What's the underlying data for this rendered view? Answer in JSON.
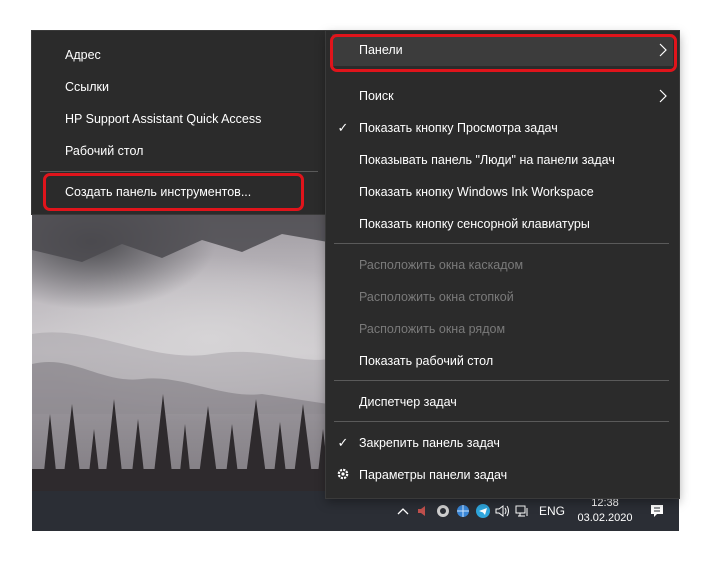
{
  "submenu": {
    "items": [
      {
        "label": "Адрес"
      },
      {
        "label": "Ссылки"
      },
      {
        "label": "HP Support Assistant Quick Access"
      },
      {
        "label": "Рабочий стол"
      }
    ],
    "create_label": "Создать панель инструментов..."
  },
  "menu": {
    "panels_label": "Панели",
    "search_label": "Поиск",
    "task_view_label": "Показать кнопку Просмотра задач",
    "people_label": "Показывать панель \"Люди\" на панели задач",
    "ink_label": "Показать кнопку Windows Ink Workspace",
    "keyboard_label": "Показать кнопку сенсорной клавиатуры",
    "cascade_label": "Расположить окна каскадом",
    "stack_label": "Расположить окна стопкой",
    "side_label": "Расположить окна рядом",
    "desktop_label": "Показать рабочий стол",
    "task_manager_label": "Диспетчер задач",
    "lock_label": "Закрепить панель задач",
    "settings_label": "Параметры панели задач"
  },
  "taskbar": {
    "language": "ENG",
    "time": "12:38",
    "date": "03.02.2020"
  },
  "colors": {
    "menu_bg": "#2b2b2b",
    "highlight": "#e0141b",
    "disabled_text": "#7a7a7a"
  }
}
